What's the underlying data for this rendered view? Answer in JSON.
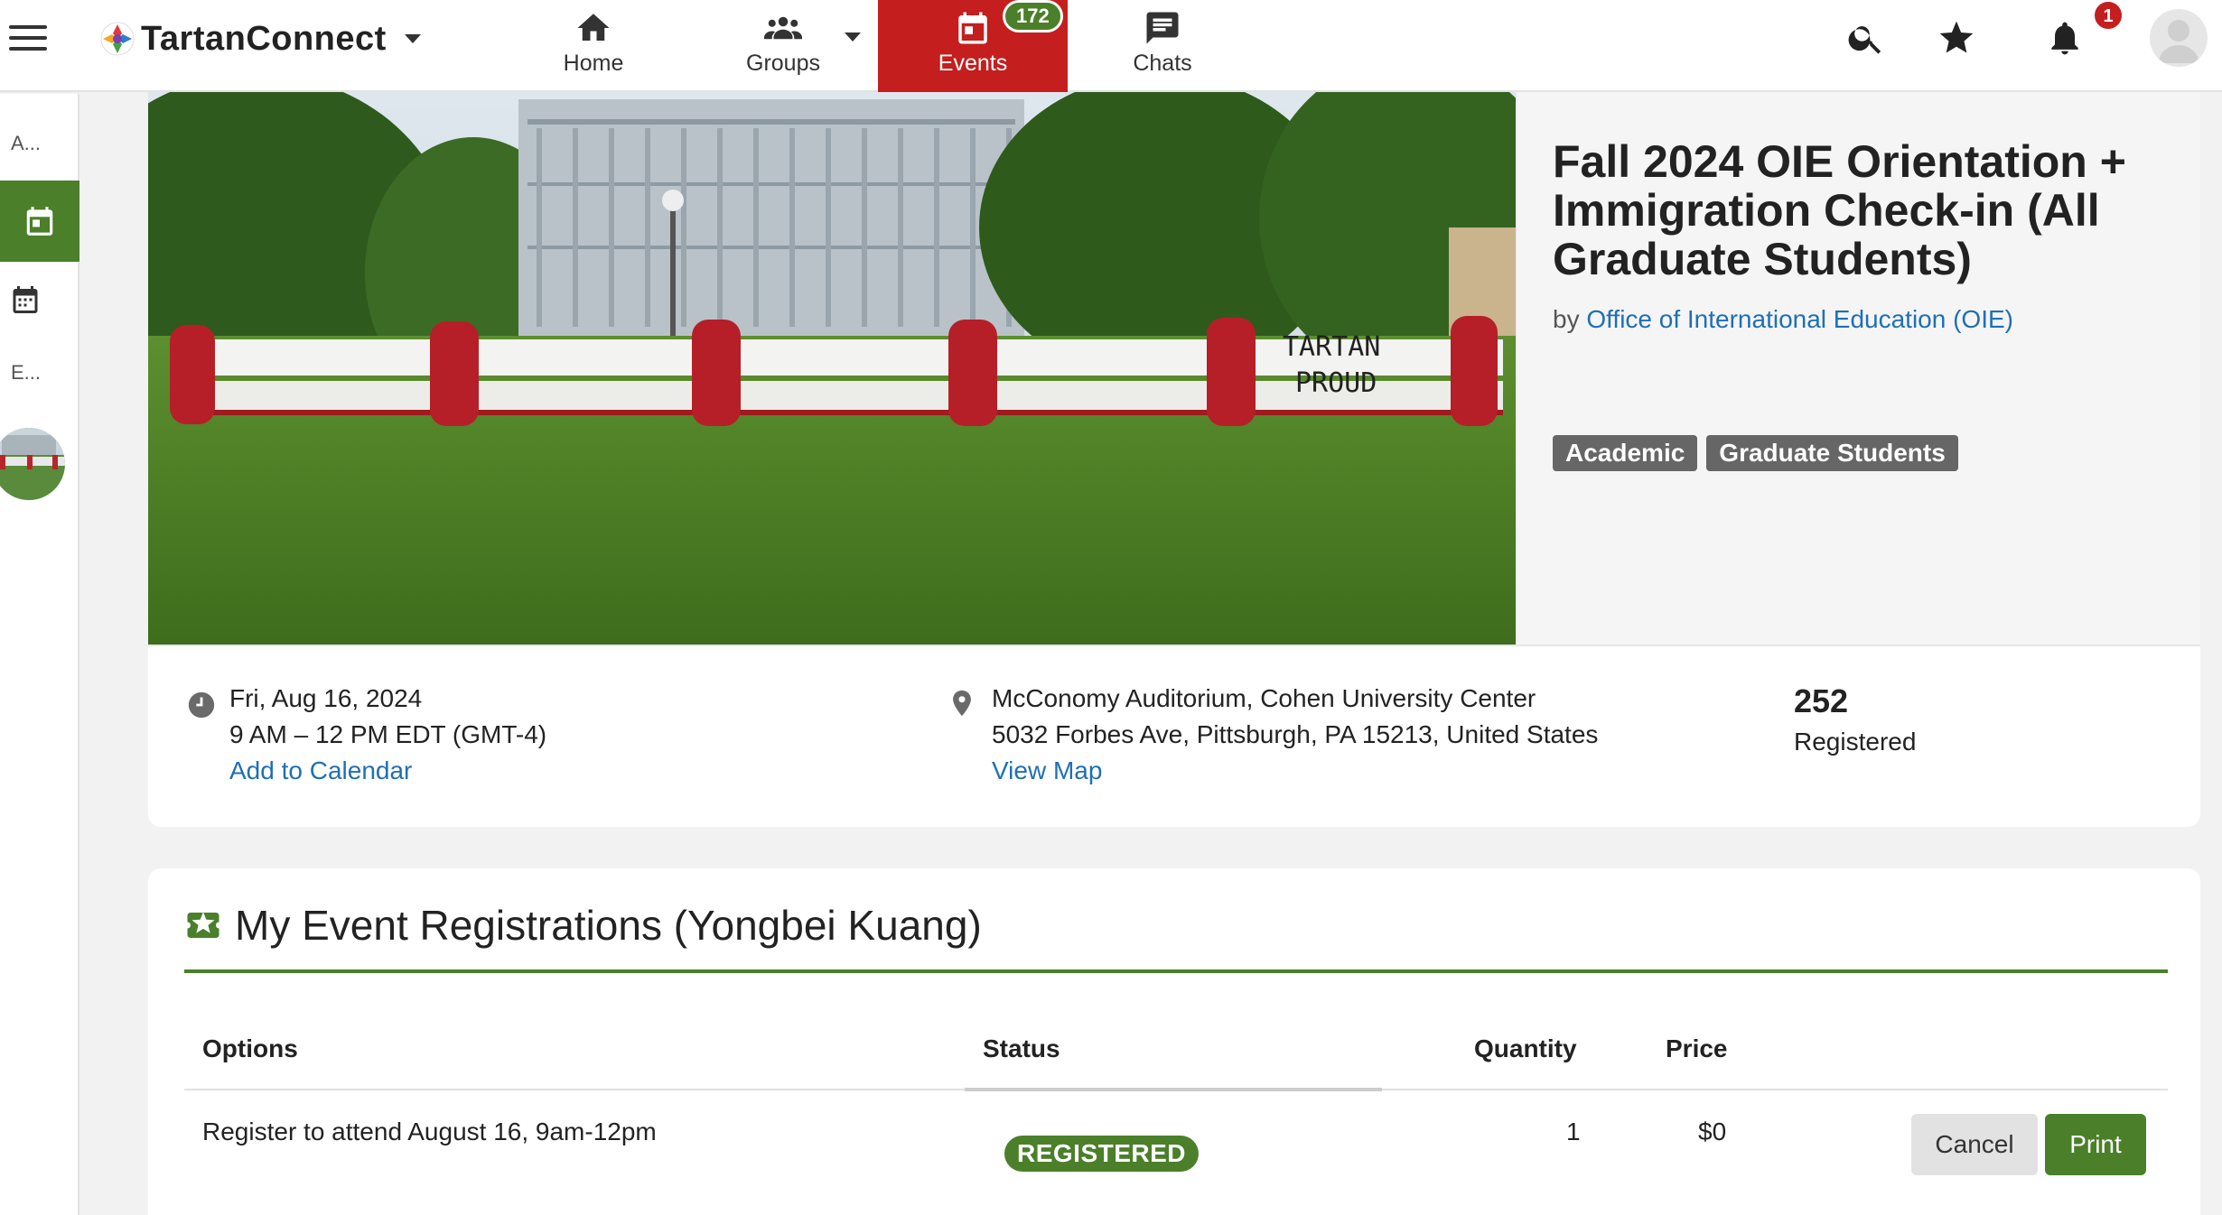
{
  "header": {
    "brand": "TartanConnect",
    "nav": [
      {
        "label": "Home",
        "icon": "home-icon"
      },
      {
        "label": "Groups",
        "icon": "groups-icon"
      },
      {
        "label": "Events",
        "icon": "calendar-icon",
        "badge": "172",
        "active": true
      },
      {
        "label": "Chats",
        "icon": "chat-icon"
      }
    ],
    "notifications_badge": "1"
  },
  "rail": {
    "item_a": "A...",
    "item_e": "E..."
  },
  "event": {
    "title": "Fall 2024 OIE Orientation + Immigration Check-in (All Graduate Students)",
    "by_prefix": "by",
    "organizer": "Office of International Education (OIE)",
    "tags": [
      "Academic",
      "Graduate Students"
    ],
    "date": "Fri, Aug 16, 2024",
    "time": "9 AM – 12 PM EDT (GMT-4)",
    "add_to_calendar": "Add to Calendar",
    "location_name": "McConomy Auditorium, Cohen University Center",
    "address": "5032 Forbes Ave, Pittsburgh, PA 15213, United States",
    "view_map": "View Map",
    "registered_count": "252",
    "registered_label": "Registered",
    "hero_sign_line1": "TARTAN",
    "hero_sign_line2": "PROUD"
  },
  "registrations": {
    "heading": "My Event Registrations (Yongbei Kuang)",
    "columns": {
      "options": "Options",
      "status": "Status",
      "quantity": "Quantity",
      "price": "Price"
    },
    "rows": [
      {
        "option": "Register to attend August 16, 9am-12pm",
        "status": "REGISTERED",
        "quantity": "1",
        "price": "$0",
        "cancel": "Cancel",
        "print": "Print"
      }
    ]
  },
  "colors": {
    "brand_red": "#c41e1e",
    "accent_green": "#4b7f2a",
    "link_blue": "#1f6fb4",
    "tag_gray": "#666666"
  }
}
